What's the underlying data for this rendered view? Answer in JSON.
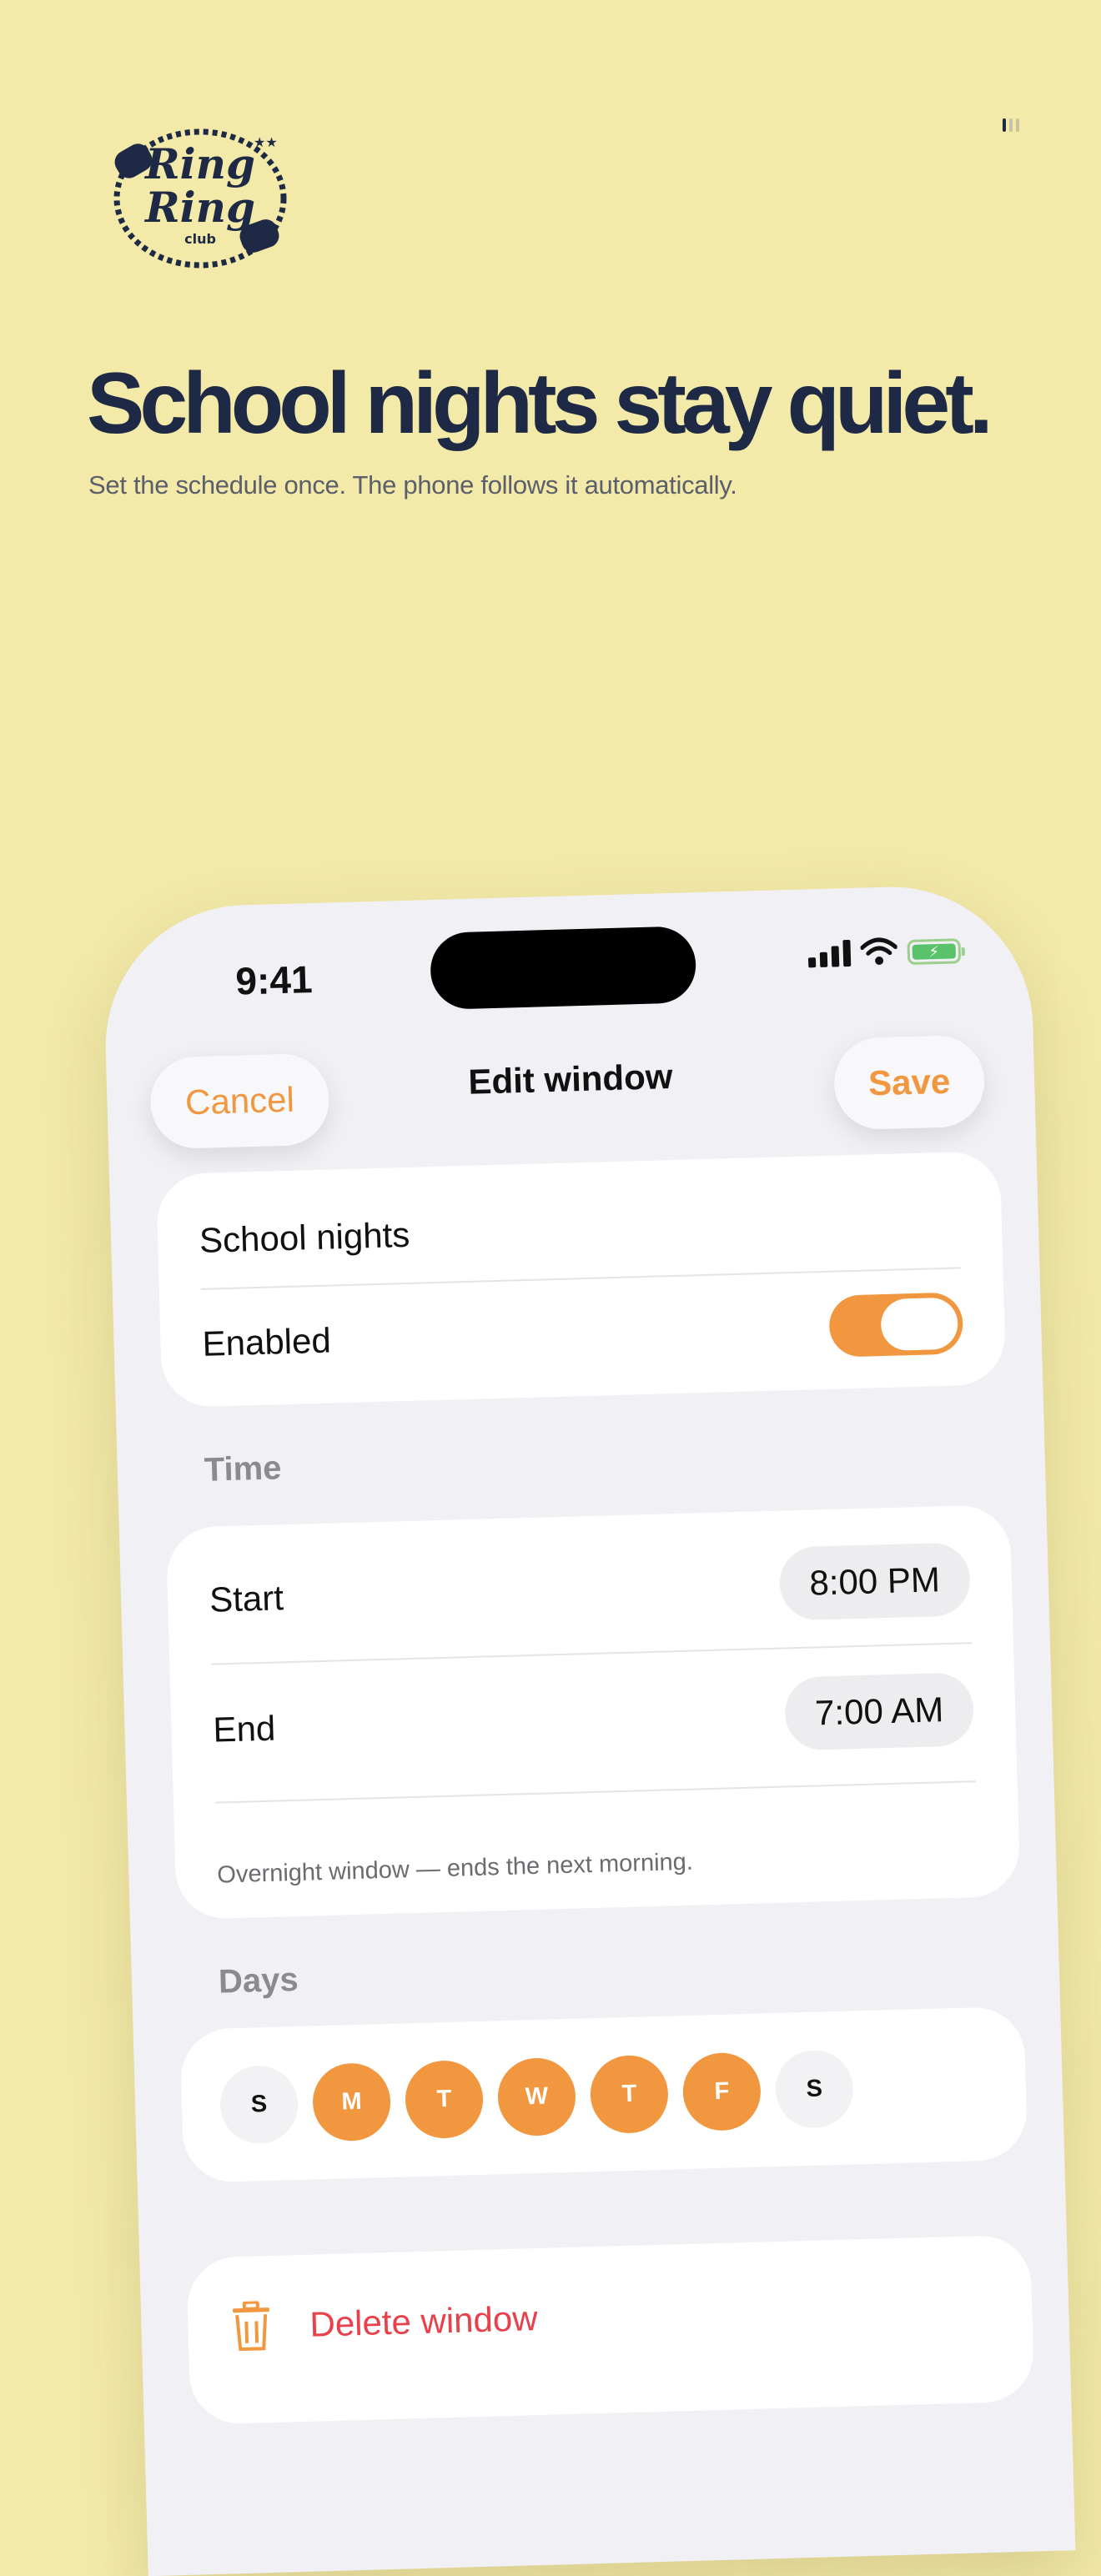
{
  "brand": {
    "logo_line1": "Ring",
    "logo_line2": "Ring",
    "logo_line3": "club"
  },
  "hero": {
    "headline": "School nights stay quiet.",
    "subline": "Set the schedule once. The phone follows it automatically."
  },
  "status_bar": {
    "time": "9:41"
  },
  "nav": {
    "cancel_label": "Cancel",
    "title": "Edit window",
    "save_label": "Save"
  },
  "window": {
    "name": "School nights",
    "enabled_label": "Enabled",
    "enabled": true
  },
  "time_section": {
    "header": "Time",
    "start_label": "Start",
    "start_value": "8:00 PM",
    "end_label": "End",
    "end_value": "7:00 AM",
    "note": "Overnight window — ends the next morning."
  },
  "days_section": {
    "header": "Days",
    "days": [
      {
        "label": "S",
        "selected": false
      },
      {
        "label": "M",
        "selected": true
      },
      {
        "label": "T",
        "selected": true
      },
      {
        "label": "W",
        "selected": true
      },
      {
        "label": "T",
        "selected": true
      },
      {
        "label": "F",
        "selected": true
      },
      {
        "label": "S",
        "selected": false
      }
    ]
  },
  "delete_label": "Delete window",
  "colors": {
    "accent": "#f0973f",
    "background": "#f3e9a8",
    "navy": "#1e2a45",
    "destructive": "#e8414b"
  }
}
